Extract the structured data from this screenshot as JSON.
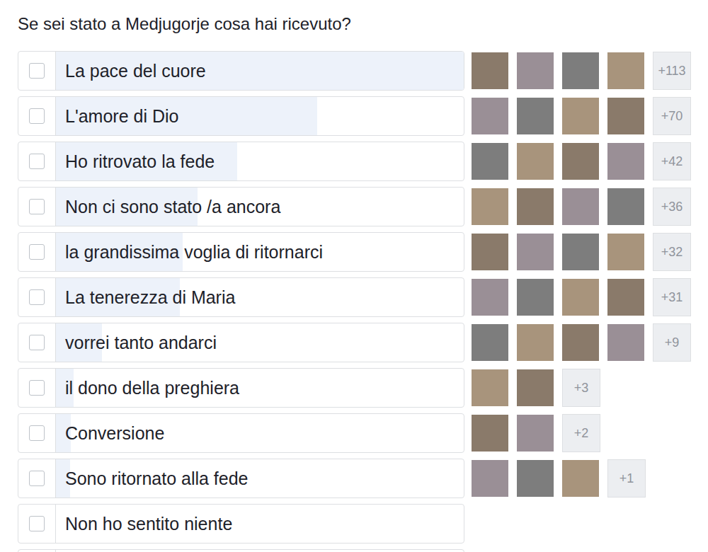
{
  "poll": {
    "question": "Se sei stato a Medjugorje cosa hai ricevuto?",
    "options": [
      {
        "label": "La pace del cuore",
        "checked": false,
        "level": 1.0,
        "avatars": 4,
        "more": "+113"
      },
      {
        "label": "L'amore di Dio",
        "checked": false,
        "level": 0.64,
        "avatars": 4,
        "more": "+70"
      },
      {
        "label": "Ho ritrovato la fede",
        "checked": false,
        "level": 0.445,
        "avatars": 4,
        "more": "+42"
      },
      {
        "label": "Non ci sono stato /a ancora",
        "checked": false,
        "level": 0.347,
        "avatars": 4,
        "more": "+36"
      },
      {
        "label": "la grandissima voglia di ritornarci",
        "checked": false,
        "level": 0.31,
        "avatars": 4,
        "more": "+32"
      },
      {
        "label": "La tenerezza di Maria",
        "checked": false,
        "level": 0.303,
        "avatars": 4,
        "more": "+31"
      },
      {
        "label": "vorrei tanto andarci",
        "checked": false,
        "level": 0.112,
        "avatars": 4,
        "more": "+9"
      },
      {
        "label": "il dono della preghiera",
        "checked": false,
        "level": 0.044,
        "avatars": 2,
        "more": "+3"
      },
      {
        "label": "Conversione",
        "checked": false,
        "level": 0.037,
        "avatars": 2,
        "more": "+2"
      },
      {
        "label": "Sono ritornato alla fede",
        "checked": false,
        "level": 0.035,
        "avatars": 3,
        "more": "+1"
      },
      {
        "label": "Non ho sentito niente",
        "checked": false,
        "level": 0,
        "avatars": 0,
        "more": ""
      },
      {
        "label": "",
        "checked": false,
        "level": 0,
        "avatars": 0,
        "more": ""
      }
    ]
  }
}
